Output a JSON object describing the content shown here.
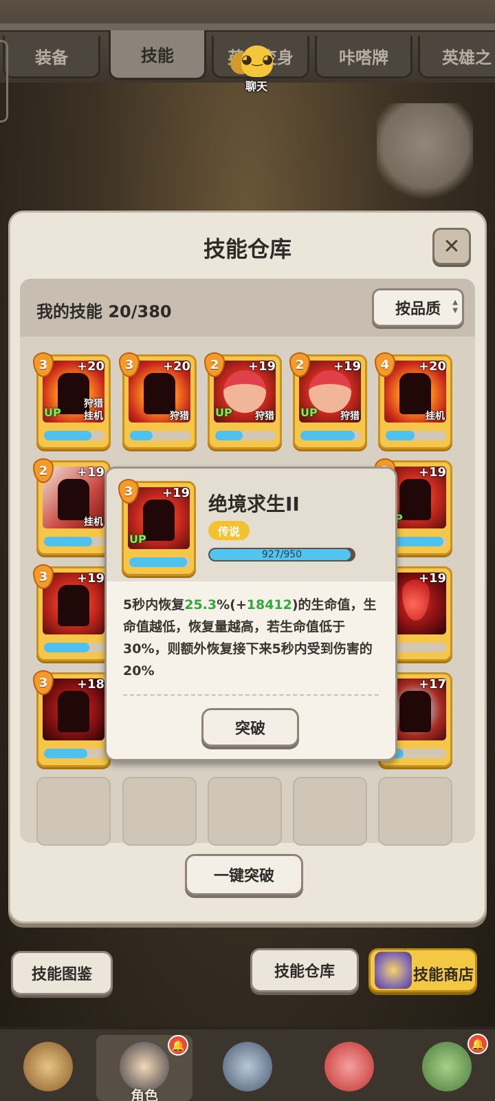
{
  "tabs": [
    {
      "label": "装备",
      "active": false
    },
    {
      "label": "技能",
      "active": true
    },
    {
      "label": "英雄变身",
      "active": false
    },
    {
      "label": "咔嗒牌",
      "active": false
    },
    {
      "label": "英雄之",
      "active": false
    }
  ],
  "chat": {
    "label": "聊天"
  },
  "modal": {
    "title": "技能仓库",
    "close_icon": "✕",
    "my_skills_label": "我的技能 20/380",
    "sort_label": "按品质",
    "bulk_breakthrough_label": "一键突破"
  },
  "skill_cards": [
    {
      "level": "3",
      "plus": "+20",
      "up": "UP",
      "tag_top": "狩猎",
      "tag": "挂机",
      "progress": 0.78,
      "art": "shadow-group"
    },
    {
      "level": "3",
      "plus": "+20",
      "up": "",
      "tag_top": "",
      "tag": "狩猎",
      "progress": 0.38,
      "art": "fist"
    },
    {
      "level": "2",
      "plus": "+19",
      "up": "UP",
      "tag_top": "",
      "tag": "狩猎",
      "progress": 0.45,
      "art": "red-hair-hero"
    },
    {
      "level": "2",
      "plus": "+19",
      "up": "UP",
      "tag_top": "",
      "tag": "狩猎",
      "progress": 0.9,
      "art": "red-hair-hero"
    },
    {
      "level": "4",
      "plus": "+20",
      "up": "",
      "tag_top": "",
      "tag": "挂机",
      "progress": 0.48,
      "art": "angry-golem"
    },
    {
      "level": "2",
      "plus": "+19",
      "up": "",
      "tag_top": "",
      "tag": "挂机",
      "progress": 0.8,
      "art": "pale-blade"
    },
    {
      "level": "3",
      "plus": "+19",
      "up": "UP",
      "tag_top": "",
      "tag": "",
      "progress": 0.95,
      "art": "survivor"
    },
    {
      "level": "3",
      "plus": "+19",
      "up": "",
      "tag_top": "",
      "tag": "",
      "progress": 0.75,
      "art": "flame-golem"
    },
    {
      "level": "",
      "plus": "+19",
      "up": "",
      "tag_top": "",
      "tag": "",
      "progress": 0.05,
      "art": "blood-drop"
    },
    {
      "level": "3",
      "plus": "+18",
      "up": "",
      "tag_top": "",
      "tag": "",
      "progress": 0.72,
      "art": "burning-brute"
    },
    {
      "level": "",
      "plus": "+17",
      "up": "",
      "tag_top": "",
      "tag": "",
      "progress": 0.3,
      "art": "shatter"
    }
  ],
  "popup": {
    "card_level": "3",
    "card_plus": "+19",
    "card_up": "UP",
    "name": "绝境求生II",
    "rarity": "传说",
    "progress_text": "927/950",
    "progress": 0.976,
    "desc_part1": "5秒内恢复",
    "desc_pct": "25.3",
    "desc_part2": "%(+",
    "desc_bonus": "18412",
    "desc_part3": ")的生命值，生命值越低，恢复量越高，若生命值低于30%，则额外恢复接下来5秒内受到伤害的20%",
    "breakthrough_label": "突破"
  },
  "bottom_buttons": {
    "codex_label": "技能图鉴",
    "warehouse_label": "技能仓库",
    "shop_label": "技能商店"
  },
  "bottom_nav": [
    {
      "label": "",
      "icon": "hunter-icon",
      "active": false
    },
    {
      "label": "角色",
      "icon": "character-icon",
      "active": true
    },
    {
      "label": "",
      "icon": "sword-shield-icon",
      "active": false
    },
    {
      "label": "",
      "icon": "dino-pet-icon",
      "active": false
    },
    {
      "label": "",
      "icon": "guild-icon",
      "active": false
    }
  ],
  "colors": {
    "accent_gold": "#f5c64a",
    "progress_blue": "#4fc1ee",
    "highlight_green": "#2faa3a",
    "rarity_gold": "#f3c22e"
  }
}
